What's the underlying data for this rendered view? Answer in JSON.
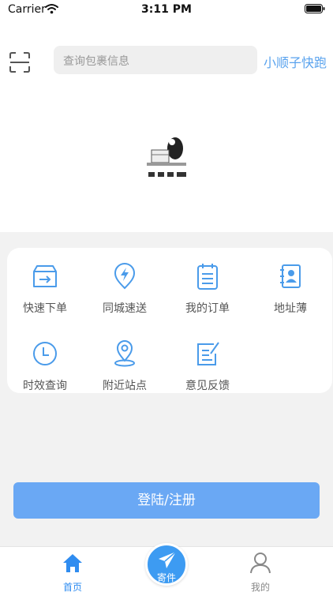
{
  "status_bar": {
    "carrier": "Carrier",
    "time": "3:11 PM"
  },
  "header": {
    "search_placeholder": "查询包裹信息",
    "brand_link": "小顺子快跑"
  },
  "features": [
    {
      "label": "快速下单",
      "icon": "fast-order-icon"
    },
    {
      "label": "同城速送",
      "icon": "lightning-pin-icon"
    },
    {
      "label": "我的订单",
      "icon": "notepad-icon"
    },
    {
      "label": "地址薄",
      "icon": "contact-book-icon"
    },
    {
      "label": "时效查询",
      "icon": "clock-icon"
    },
    {
      "label": "附近站点",
      "icon": "location-pin-icon"
    },
    {
      "label": "意见反馈",
      "icon": "edit-note-icon"
    }
  ],
  "login_button": "登陆/注册",
  "tab_bar": {
    "home": "首页",
    "send": "寄件",
    "mine": "我的"
  },
  "colors": {
    "accent": "#5aa3ee",
    "tab_active": "#2f8cf0",
    "button": "#6aa8f4"
  }
}
